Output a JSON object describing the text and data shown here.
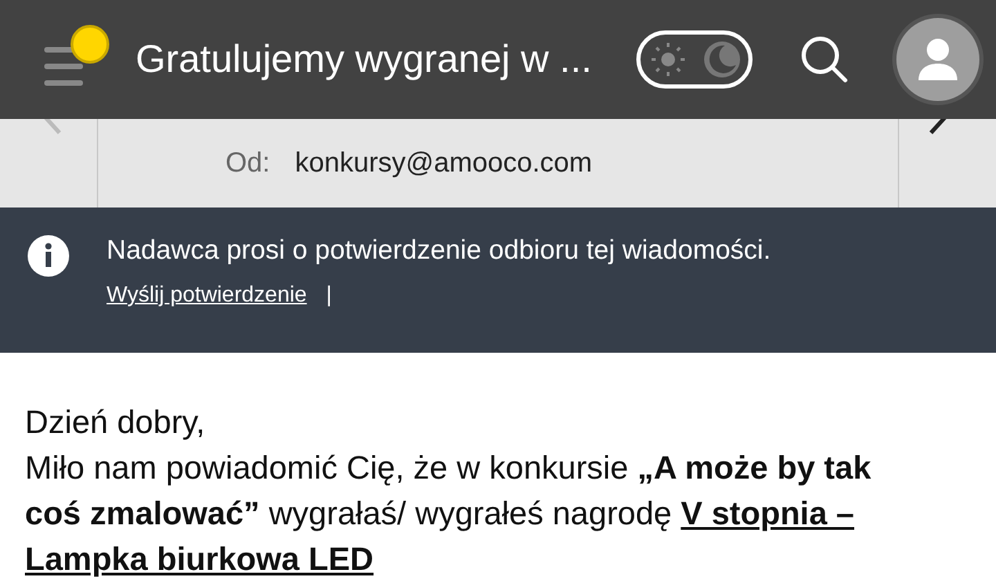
{
  "header": {
    "title": "Gratulujemy wygranej w ...",
    "notification": true,
    "dark_mode": true
  },
  "sender": {
    "label": "Od:",
    "address": "konkursy@amooco.com"
  },
  "receipt_notice": {
    "message": "Nadawca prosi o potwierdzenie odbioru tej wiadomości.",
    "action": "Wyślij potwierdzenie",
    "separator": "|"
  },
  "body": {
    "greeting": "Dzień dobry,",
    "paragraph": [
      {
        "text": "Miło nam powiadomić Cię, że w konkursie ",
        "bold": false,
        "underline": false
      },
      {
        "text": "„A może by tak coś zmalować”",
        "bold": true,
        "underline": false
      },
      {
        "text": " wygrałaś/ wygrałeś nagrodę ",
        "bold": false,
        "underline": false
      },
      {
        "text": "V stopnia – Lampka biurkowa LED",
        "bold": true,
        "underline": true
      }
    ]
  }
}
